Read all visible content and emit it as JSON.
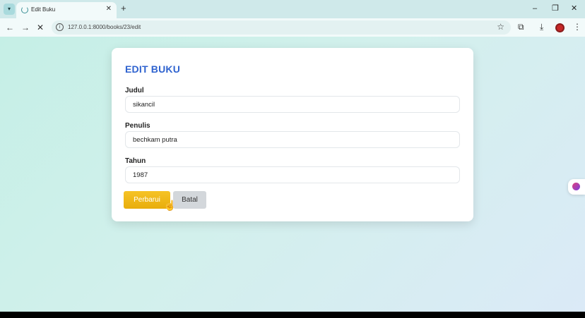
{
  "browser": {
    "tab_title": "Edit Buku",
    "tab_menu_icon": "chevron-down-icon",
    "url": "127.0.0.1:8000/books/23/edit",
    "accent": "#cfe9ea"
  },
  "form": {
    "title": "EDIT BUKU",
    "fields": [
      {
        "label": "Judul",
        "value": "sikancil"
      },
      {
        "label": "Penulis",
        "value": "bechkam putra"
      },
      {
        "label": "Tahun",
        "value": "1987"
      }
    ],
    "update_label": "Perbarui",
    "cancel_label": "Batal",
    "title_color": "#2f63cf",
    "update_color": "#f0b91a"
  }
}
